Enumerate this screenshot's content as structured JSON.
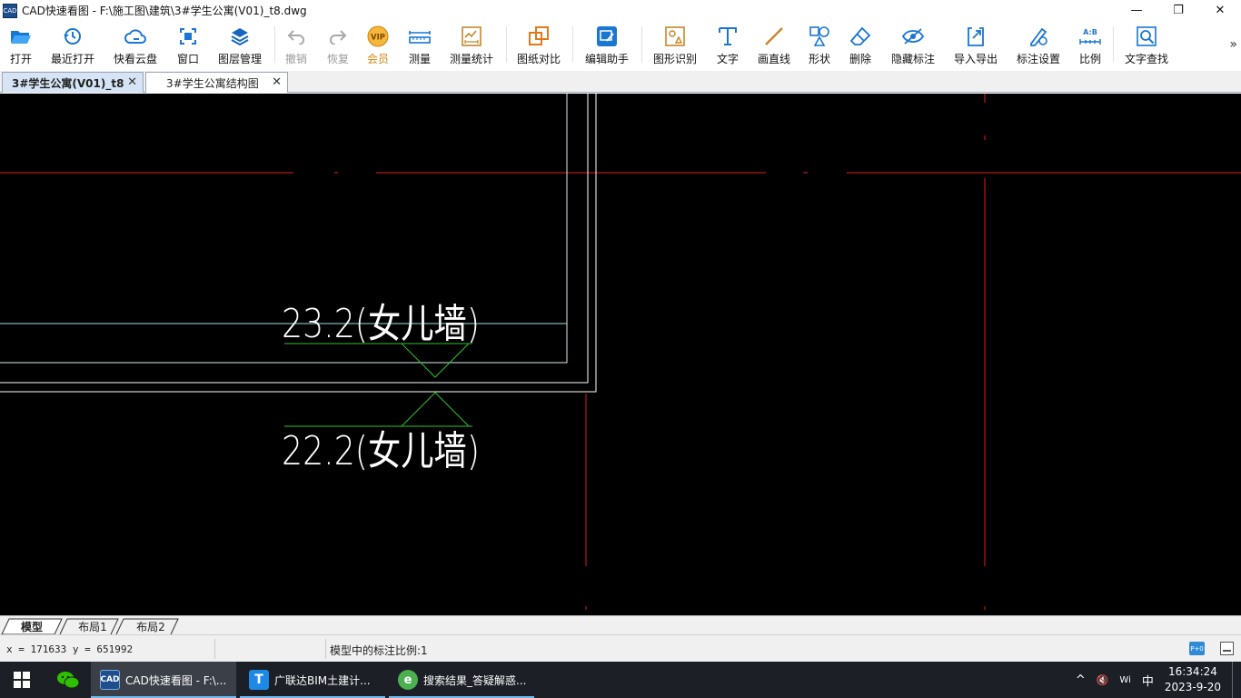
{
  "window": {
    "title": "CAD快速看图 - F:\\施工图\\建筑\\3#学生公寓(V01)_t8.dwg",
    "app_icon_text": "CAD",
    "minimize": "—",
    "maximize": "❐",
    "close": "✕"
  },
  "toolbar": {
    "items": [
      {
        "label": "打开",
        "icon": "folder-open-icon"
      },
      {
        "label": "最近打开",
        "icon": "history-icon"
      },
      {
        "label": "快看云盘",
        "icon": "cloud-icon"
      },
      {
        "label": "窗口",
        "icon": "window-icon"
      },
      {
        "label": "图层管理",
        "icon": "layers-icon"
      },
      {
        "label": "撤销",
        "icon": "undo-icon"
      },
      {
        "label": "恢复",
        "icon": "redo-icon"
      },
      {
        "label": "会员",
        "icon": "vip-icon",
        "badge": "VIP"
      },
      {
        "label": "测量",
        "icon": "ruler-icon"
      },
      {
        "label": "测量统计",
        "icon": "measure-stats-icon"
      },
      {
        "label": "图纸对比",
        "icon": "compare-icon"
      },
      {
        "label": "编辑助手",
        "icon": "edit-assistant-icon"
      },
      {
        "label": "图形识别",
        "icon": "shape-recognition-icon"
      },
      {
        "label": "文字",
        "icon": "text-icon"
      },
      {
        "label": "画直线",
        "icon": "line-icon"
      },
      {
        "label": "形状",
        "icon": "shape-icon"
      },
      {
        "label": "删除",
        "icon": "eraser-icon"
      },
      {
        "label": "隐藏标注",
        "icon": "hide-eye-icon"
      },
      {
        "label": "导入导出",
        "icon": "import-export-icon"
      },
      {
        "label": "标注设置",
        "icon": "annotation-settings-icon"
      },
      {
        "label": "比例",
        "icon": "scale-icon",
        "badge": "A:B"
      },
      {
        "label": "文字查找",
        "icon": "text-search-icon"
      }
    ],
    "more": "»"
  },
  "tabs": [
    {
      "label": "3#学生公寓(V01)_t8",
      "close": "✕"
    },
    {
      "label": "3#学生公寓结构图",
      "close": "✕"
    }
  ],
  "drawing": {
    "elevation_top": "23.2(女儿墙)",
    "elevation_bottom": "22.2(女儿墙)"
  },
  "layouts": [
    "模型",
    "布局1",
    "布局2"
  ],
  "status": {
    "coords": "x = 171633  y = 651992",
    "scale": "模型中的标注比例:1",
    "icon1": "P+0"
  },
  "taskbar": {
    "apps": [
      {
        "label": "CAD快速看图 - F:\\...",
        "icon_text": "CAD",
        "color": "#1f4e8c"
      },
      {
        "label": "广联达BIM土建计...",
        "icon_text": "T",
        "color": "#1e88e5"
      },
      {
        "label": "搜索结果_答疑解惑...",
        "icon_text": "e",
        "color": "#4caf50"
      }
    ],
    "tray": {
      "chevron": "^",
      "volume": "🔇",
      "network": "Wi",
      "ime": "中",
      "time": "16:34:24",
      "date": "2023-9-20"
    }
  },
  "colors": {
    "canvas_bg": "#000000",
    "axis_red": "#e01b1b",
    "wall_white": "#ffffff",
    "wall_cyan": "#b9f2f2",
    "level_green": "#2ec02e"
  }
}
